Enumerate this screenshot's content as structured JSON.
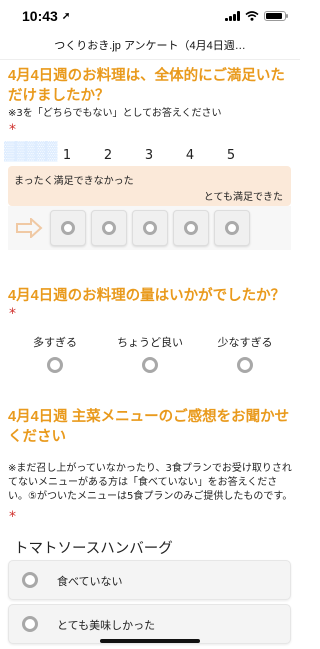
{
  "status": {
    "time": "10:43",
    "location_glyph": "➚"
  },
  "title": "つくりおき.jp アンケート（4月4日週…",
  "q1": {
    "title": "4月4日週のお料理は、全体的にご満足いただけましたか？",
    "note": "※3を「どちらでもない」としてお答えください",
    "required": "*",
    "scale": [
      "1",
      "2",
      "3",
      "4",
      "5"
    ],
    "low_label": "まったく満足できなかった",
    "high_label": "とても満足できた"
  },
  "q2": {
    "title": "4月4日週のお料理の量はいかがでしたか？",
    "required": "*",
    "options": [
      "多すぎる",
      "ちょうど良い",
      "少なすぎる"
    ]
  },
  "q3": {
    "title": "4月4日週 主菜メニューのご感想をお聞かせください",
    "note": "※まだ召し上がっていなかったり、3食プランでお受け取りされてないメニューがある方は「食べていない」をお答えください。⑤がついたメニューは5食プランのみご提供したものです。",
    "required": "*",
    "item_name": "トマトソースハンバーグ",
    "choices": [
      "食べていない",
      "とても美味しかった"
    ]
  },
  "colors": {
    "accent": "#e99a1d",
    "required": "#d0312d",
    "rating_bg": "#fbe9d9"
  }
}
